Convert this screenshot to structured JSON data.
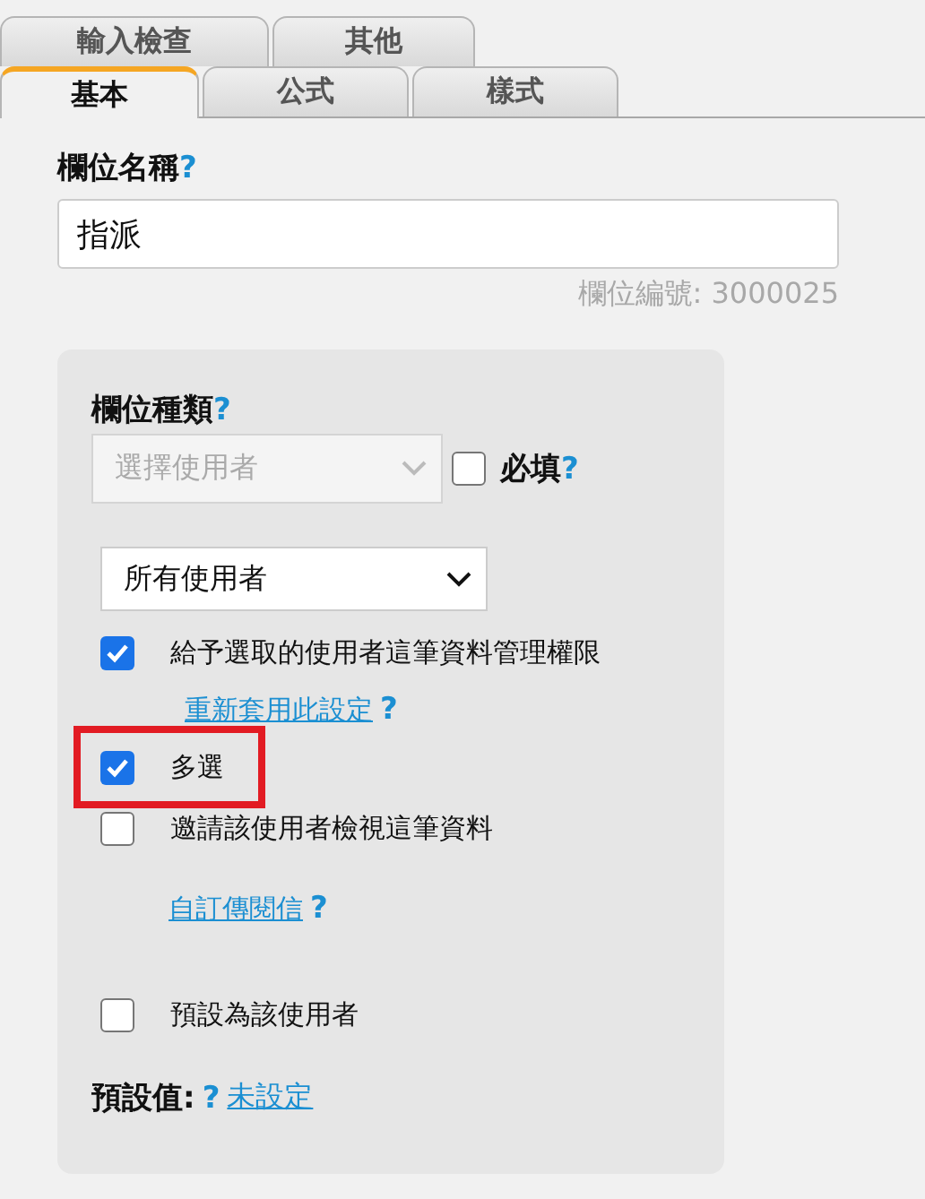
{
  "tabs_back": [
    {
      "label": "輸入檢查",
      "selected": false
    },
    {
      "label": "其他",
      "selected": false
    }
  ],
  "tabs_front": [
    {
      "label": "基本",
      "selected": true
    },
    {
      "label": "公式",
      "selected": false
    },
    {
      "label": "樣式",
      "selected": false
    }
  ],
  "field_name": {
    "label": "欄位名稱",
    "help": "?",
    "value": "指派",
    "field_number": "欄位編號: 3000025"
  },
  "field_type": {
    "label": "欄位種類",
    "help": "?",
    "select": {
      "value": "選擇使用者",
      "disabled": true
    },
    "required": {
      "label": "必填",
      "help": "?",
      "checked": false
    }
  },
  "user_scope": {
    "value": "所有使用者"
  },
  "options": [
    {
      "kind": "checkbox",
      "label": "給予選取的使用者這筆資料管理權限",
      "checked": true,
      "highlighted": false
    },
    {
      "kind": "link",
      "label": "重新套用此設定",
      "help": "?"
    },
    {
      "kind": "checkbox",
      "label": "多選",
      "checked": true,
      "highlighted": true
    },
    {
      "kind": "checkbox",
      "label": "邀請該使用者檢視這筆資料",
      "checked": false,
      "highlighted": false
    },
    {
      "kind": "link",
      "label": "自訂傳閱信",
      "help": "?"
    },
    {
      "kind": "checkbox",
      "label": "預設為該使用者",
      "checked": false,
      "highlighted": false
    }
  ],
  "default_value": {
    "label": "預設值:",
    "help": "?",
    "link": "未設定"
  }
}
